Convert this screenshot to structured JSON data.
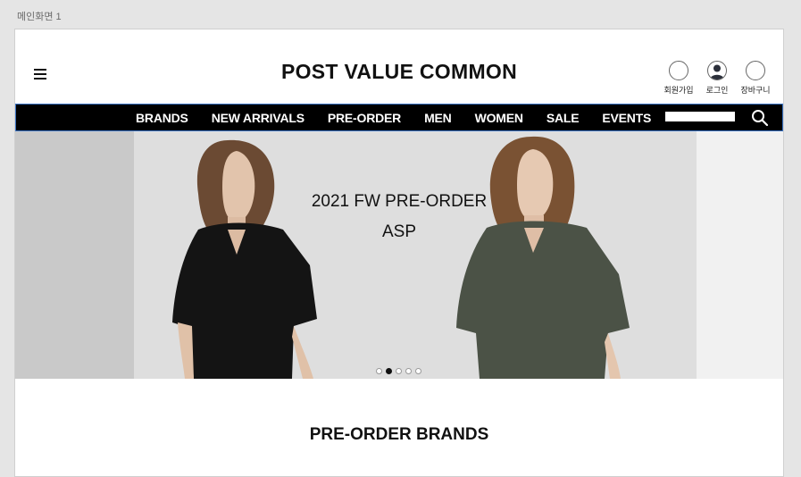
{
  "frame": {
    "label": "메인화면 1"
  },
  "header": {
    "logo": "POST VALUE COMMON",
    "user_menu": [
      {
        "label": "회원가입",
        "icon": "empty-circle-icon"
      },
      {
        "label": "로그인",
        "icon": "user-icon"
      },
      {
        "label": "장바구니",
        "icon": "empty-circle-icon"
      }
    ]
  },
  "nav": {
    "items": [
      "BRANDS",
      "NEW ARRIVALS",
      "PRE-ORDER",
      "MEN",
      "WOMEN",
      "SALE",
      "EVENTS"
    ],
    "search_placeholder": "",
    "search_icon": "search-icon"
  },
  "hero": {
    "title": "2021 FW PRE-ORDER",
    "subtitle": "ASP",
    "slide_count": 5,
    "active_slide": 2
  },
  "section": {
    "title": "PRE-ORDER BRANDS"
  },
  "colors": {
    "nav_bg": "#000000",
    "nav_border": "#3b73c4",
    "text": "#111111",
    "shirt_left": "#111111",
    "shirt_right": "#4b5246"
  }
}
